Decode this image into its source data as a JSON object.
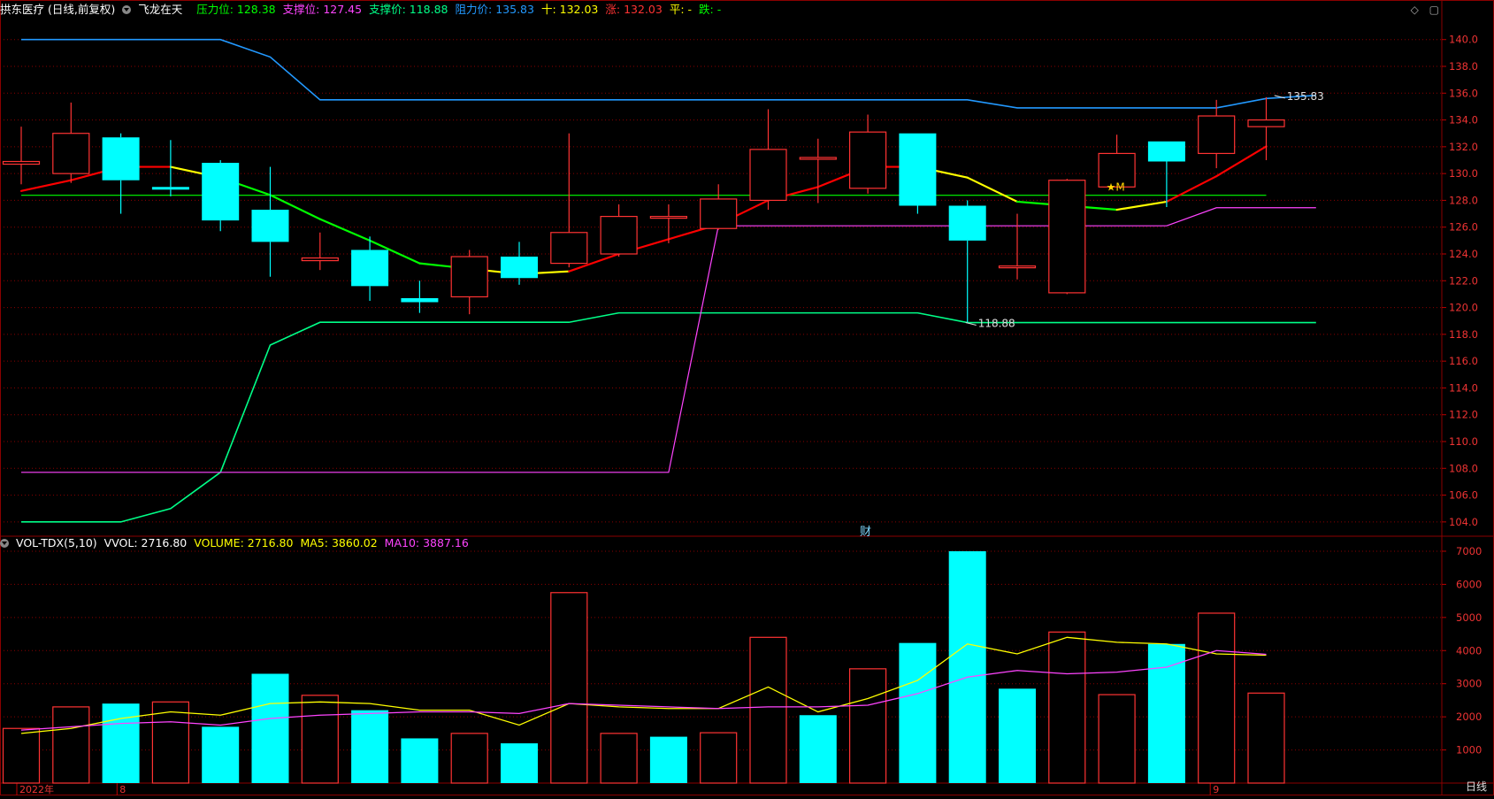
{
  "header": {
    "stock_name": "拱东医疗",
    "period": "(日线,前复权)",
    "indicator_name": "飞龙在天",
    "items": [
      {
        "label": "压力位:",
        "value": "128.38",
        "color": "#00ff00"
      },
      {
        "label": "支撑位:",
        "value": "127.45",
        "color": "#ff44ff"
      },
      {
        "label": "支撑价:",
        "value": "118.88",
        "color": "#00ff88"
      },
      {
        "label": "阻力价:",
        "value": "135.83",
        "color": "#2299ff"
      },
      {
        "label": "十:",
        "value": "132.03",
        "color": "#ffff00"
      },
      {
        "label": "涨:",
        "value": "132.03",
        "color": "#ff3333"
      },
      {
        "label": "平:",
        "value": "-",
        "color": "#ffff00"
      },
      {
        "label": "跌:",
        "value": "-",
        "color": "#00ff00"
      }
    ]
  },
  "volume_header": {
    "name": "VOL-TDX(5,10)",
    "items": [
      {
        "label": "VVOL:",
        "value": "2716.80",
        "color": "#ffffff"
      },
      {
        "label": "VOLUME:",
        "value": "2716.80",
        "color": "#ffff00"
      },
      {
        "label": "MA5:",
        "value": "3860.02",
        "color": "#ffff00"
      },
      {
        "label": "MA10:",
        "value": "3887.16",
        "color": "#ff44ff"
      }
    ]
  },
  "annotations": {
    "cai_marker": "财",
    "period_label": "日线",
    "m_marker": "★M"
  },
  "colors": {
    "up": "#ff3333",
    "down": "#00ffff",
    "resistance": "#2299ff",
    "support_price": "#00ff88",
    "support_level": "#ff44ff",
    "pressure_level": "#00ff00",
    "ma_yellow": "#ffff00",
    "ma_red": "#ff0000",
    "ma_green": "#00ff00",
    "grid": "#8b0000"
  },
  "chart_data": [
    {
      "type": "candlestick",
      "title": "拱东医疗 (日线,前复权)",
      "ylim": [
        103,
        141.5
      ],
      "yticks": [
        104,
        106,
        108,
        110,
        112,
        114,
        116,
        118,
        120,
        122,
        124,
        126,
        128,
        130,
        132,
        134,
        136,
        138,
        140
      ],
      "x_labels": [
        {
          "index": 0,
          "text": "2022年"
        },
        {
          "index": 1,
          "text": "8"
        },
        {
          "index": 24,
          "text": "9"
        }
      ],
      "candles": [
        {
          "o": 130.7,
          "h": 133.5,
          "l": 129.2,
          "c": 130.9
        },
        {
          "o": 130.0,
          "h": 135.3,
          "l": 129.3,
          "c": 133.0
        },
        {
          "o": 132.7,
          "h": 133.0,
          "l": 127.0,
          "c": 129.5
        },
        {
          "o": 129.0,
          "h": 132.5,
          "l": 128.3,
          "c": 128.8
        },
        {
          "o": 130.8,
          "h": 131.0,
          "l": 125.7,
          "c": 126.5
        },
        {
          "o": 127.3,
          "h": 130.5,
          "l": 122.3,
          "c": 124.9
        },
        {
          "o": 123.5,
          "h": 125.6,
          "l": 122.8,
          "c": 123.7
        },
        {
          "o": 124.3,
          "h": 125.3,
          "l": 120.5,
          "c": 121.6
        },
        {
          "o": 120.7,
          "h": 122.0,
          "l": 119.6,
          "c": 120.4
        },
        {
          "o": 120.8,
          "h": 124.3,
          "l": 119.5,
          "c": 123.8
        },
        {
          "o": 123.8,
          "h": 124.9,
          "l": 121.7,
          "c": 122.2
        },
        {
          "o": 123.3,
          "h": 133.0,
          "l": 123.0,
          "c": 125.6
        },
        {
          "o": 124.0,
          "h": 127.7,
          "l": 123.8,
          "c": 126.8
        },
        {
          "o": 126.8,
          "h": 127.7,
          "l": 124.8,
          "c": 126.8
        },
        {
          "o": 125.9,
          "h": 129.2,
          "l": 125.8,
          "c": 128.1
        },
        {
          "o": 128.0,
          "h": 134.8,
          "l": 127.3,
          "c": 131.8
        },
        {
          "o": 131.2,
          "h": 132.6,
          "l": 127.8,
          "c": 131.2
        },
        {
          "o": 128.9,
          "h": 134.4,
          "l": 128.5,
          "c": 133.1
        },
        {
          "o": 133.0,
          "h": 133.0,
          "l": 127.0,
          "c": 127.6
        },
        {
          "o": 127.6,
          "h": 128.0,
          "l": 118.9,
          "c": 125.0
        },
        {
          "o": 123.1,
          "h": 127.0,
          "l": 122.1,
          "c": 123.1
        },
        {
          "o": 121.1,
          "h": 129.6,
          "l": 121.0,
          "c": 129.5
        },
        {
          "o": 129.0,
          "h": 132.9,
          "l": 129.0,
          "c": 131.5
        },
        {
          "o": 132.4,
          "h": 132.4,
          "l": 127.5,
          "c": 130.9
        },
        {
          "o": 131.5,
          "h": 135.5,
          "l": 130.4,
          "c": 134.3
        },
        {
          "o": 133.5,
          "h": 135.7,
          "l": 131.0,
          "c": 134.0
        }
      ],
      "resistance_line": [
        140,
        140,
        140,
        140,
        140,
        138.7,
        135.5,
        135.5,
        135.5,
        135.5,
        135.5,
        135.5,
        135.5,
        135.5,
        135.5,
        135.5,
        135.5,
        135.5,
        135.5,
        135.5,
        134.9,
        134.9,
        134.9,
        134.9,
        134.9,
        135.6,
        135.83
      ],
      "support_price_line": [
        104.0,
        104.0,
        104.0,
        105.0,
        107.7,
        117.2,
        118.9,
        118.9,
        118.9,
        118.9,
        118.9,
        118.9,
        119.6,
        119.6,
        119.6,
        119.6,
        119.6,
        119.6,
        119.6,
        118.88,
        118.88,
        118.88,
        118.88,
        118.88,
        118.88,
        118.88,
        118.88
      ],
      "support_level_line": [
        107.7,
        107.7,
        107.7,
        107.7,
        107.7,
        107.7,
        107.7,
        107.7,
        107.7,
        107.7,
        107.7,
        107.7,
        107.7,
        107.7,
        126.1,
        126.1,
        126.1,
        126.1,
        126.1,
        126.1,
        126.1,
        126.1,
        126.1,
        126.1,
        127.45,
        127.45,
        127.45
      ],
      "pressure_level": 128.38,
      "trend_line": [
        128.7,
        129.5,
        130.5,
        130.5,
        129.7,
        128.4,
        126.6,
        125.0,
        123.3,
        122.9,
        122.5,
        122.7,
        124.0,
        125.1,
        126.2,
        128.0,
        129.0,
        130.5,
        130.5,
        129.7,
        127.9,
        127.6,
        127.3,
        127.9,
        129.8,
        132.03
      ],
      "trend_colors": [
        "red",
        "red",
        "red",
        "yellow",
        "green",
        "green",
        "green",
        "green",
        "green",
        "yellow",
        "yellow",
        "red",
        "red",
        "red",
        "red",
        "red",
        "red",
        "red",
        "yellow",
        "yellow",
        "green",
        "green",
        "yellow",
        "red",
        "red"
      ],
      "labels": [
        {
          "index": 25.2,
          "value": 135.83,
          "text": "135.83"
        },
        {
          "index": 19,
          "value": 118.88,
          "text": "118.88"
        }
      ]
    },
    {
      "type": "bar",
      "title": "VOL-TDX(5,10)",
      "ylim": [
        0,
        7400
      ],
      "yticks": [
        1000,
        2000,
        3000,
        4000,
        5000,
        6000,
        7000
      ],
      "values": [
        1650,
        2300,
        2400,
        2450,
        1700,
        3300,
        2650,
        2200,
        1350,
        1500,
        1200,
        5750,
        1500,
        1400,
        1520,
        4400,
        2050,
        3450,
        4230,
        7000,
        2850,
        4560,
        2670,
        4200,
        5130,
        2716.8
      ],
      "up": [
        true,
        true,
        false,
        true,
        false,
        false,
        true,
        false,
        false,
        true,
        false,
        true,
        true,
        false,
        true,
        true,
        false,
        true,
        false,
        false,
        false,
        true,
        true,
        false,
        true,
        true
      ],
      "ma5": [
        1500,
        1650,
        1950,
        2150,
        2050,
        2400,
        2450,
        2400,
        2200,
        2200,
        1750,
        2400,
        2300,
        2250,
        2250,
        2900,
        2150,
        2550,
        3100,
        4200,
        3900,
        4400,
        4250,
        4200,
        3900,
        3860.02
      ],
      "ma10": [
        1600,
        1700,
        1800,
        1850,
        1750,
        1950,
        2050,
        2100,
        2150,
        2150,
        2100,
        2400,
        2350,
        2300,
        2250,
        2300,
        2300,
        2350,
        2700,
        3200,
        3400,
        3300,
        3350,
        3500,
        4000,
        3887.16
      ]
    }
  ]
}
